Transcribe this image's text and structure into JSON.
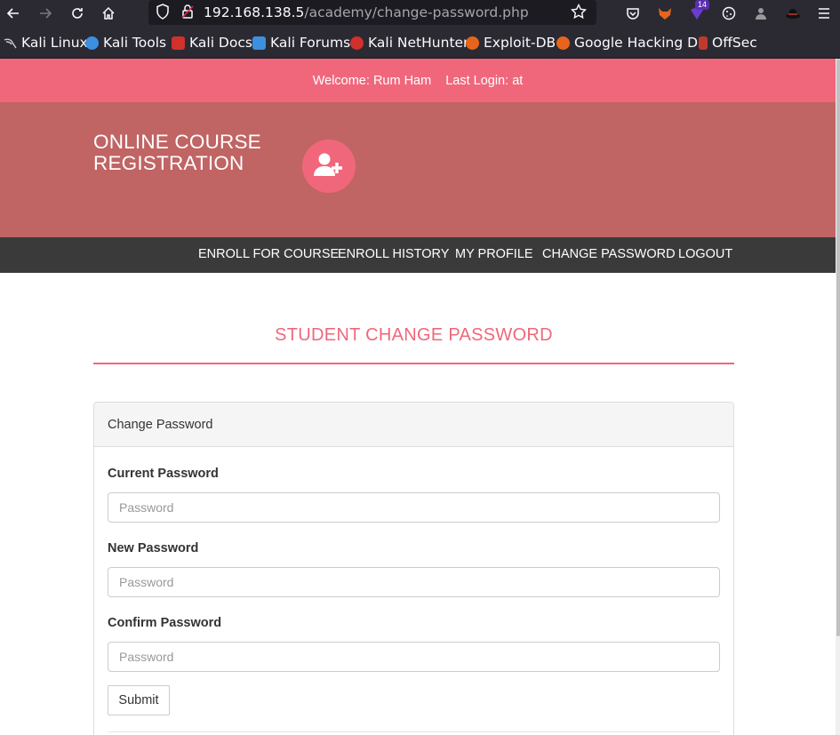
{
  "browser": {
    "url_host": "192.168.138.5",
    "url_path": "/academy/change-password.php",
    "extension_badge": "14",
    "bookmarks": [
      {
        "label": "Kali Linux",
        "color": "#9aa0a6"
      },
      {
        "label": "Kali Tools",
        "color": "#3d8fe0"
      },
      {
        "label": "Kali Docs",
        "color": "#d0312d"
      },
      {
        "label": "Kali Forums",
        "color": "#3d8fe0"
      },
      {
        "label": "Kali NetHunter",
        "color": "#d0312d"
      },
      {
        "label": "Exploit-DB",
        "color": "#e8641b"
      },
      {
        "label": "Google Hacking DB",
        "color": "#e8641b"
      },
      {
        "label": "OffSec",
        "color": "#c0392b"
      }
    ]
  },
  "topbar": {
    "welcome_label": "Welcome:",
    "user_name": "Rum Ham",
    "last_login_label": "Last Login:",
    "last_login_value": "at"
  },
  "header": {
    "site_title": "ONLINE COURSE REGISTRATION",
    "logo_icon": "user-plus-icon"
  },
  "nav": {
    "items": [
      "ENROLL FOR COURSE",
      "ENROLL HISTORY",
      "MY PROFILE",
      "CHANGE PASSWORD",
      "LOGOUT"
    ]
  },
  "main": {
    "page_heading": "STUDENT CHANGE PASSWORD",
    "panel_title": "Change Password",
    "fields": [
      {
        "label": "Current Password",
        "placeholder": "Password",
        "value": ""
      },
      {
        "label": "New Password",
        "placeholder": "Password",
        "value": ""
      },
      {
        "label": "Confirm Password",
        "placeholder": "Password",
        "value": ""
      }
    ],
    "submit_label": "Submit"
  },
  "colors": {
    "accent": "#f0677b",
    "header_bg": "#c06464",
    "nav_bg": "#3a3a3a"
  }
}
